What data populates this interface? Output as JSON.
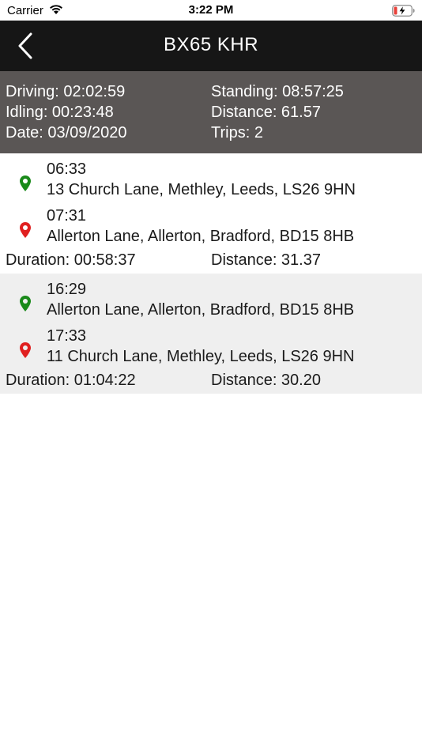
{
  "status_bar": {
    "carrier": "Carrier",
    "time": "3:22 PM",
    "wifi_icon": "wifi-icon",
    "battery_icon": "battery-charging-icon"
  },
  "nav": {
    "title": "BX65 KHR",
    "back_icon": "chevron-left-icon"
  },
  "summary": {
    "driving": "Driving: 02:02:59",
    "standing": "Standing: 08:57:25",
    "idling": "Idling: 00:23:48",
    "distance": "Distance: 61.57",
    "date": "Date: 03/09/2020",
    "trips": "Trips: 2"
  },
  "trips": [
    {
      "start": {
        "time": "06:33",
        "address": "13 Church Lane, Methley, Leeds, LS26 9HN",
        "pin_color": "#1a8a1a"
      },
      "end": {
        "time": "07:31",
        "address": "Allerton Lane, Allerton, Bradford, BD15 8HB",
        "pin_color": "#e02020"
      },
      "duration": "Duration: 00:58:37",
      "distance": "Distance: 31.37"
    },
    {
      "start": {
        "time": "16:29",
        "address": "Allerton Lane, Allerton, Bradford, BD15 8HB",
        "pin_color": "#1a8a1a"
      },
      "end": {
        "time": "17:33",
        "address": "11 Church Lane, Methley, Leeds, LS26 9HN",
        "pin_color": "#e02020"
      },
      "duration": "Duration: 01:04:22",
      "distance": "Distance: 30.20"
    }
  ],
  "colors": {
    "nav_background": "#161616",
    "summary_background": "#5a5655",
    "alt_row_background": "#efefef",
    "start_pin": "#1a8a1a",
    "end_pin": "#e02020"
  }
}
